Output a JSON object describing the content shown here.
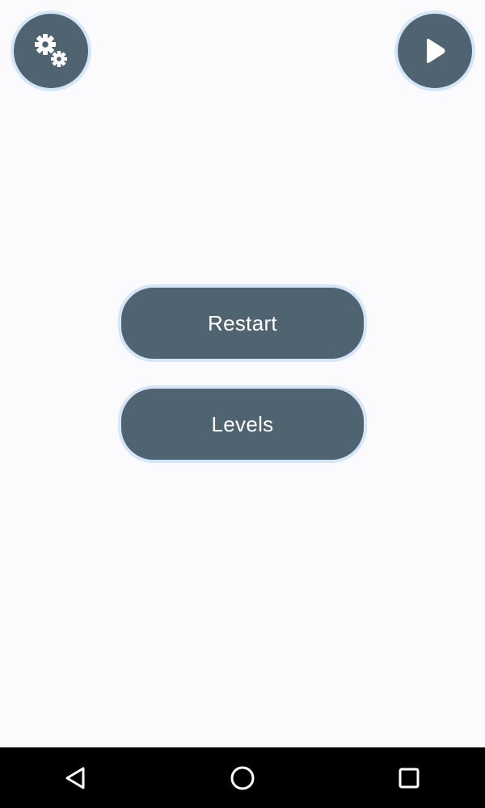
{
  "top_bar": {
    "settings_icon": "gears-icon",
    "play_icon": "play-icon"
  },
  "menu": {
    "restart_label": "Restart",
    "levels_label": "Levels"
  },
  "system_nav": {
    "back_icon": "triangle-back-icon",
    "home_icon": "circle-home-icon",
    "recents_icon": "square-recents-icon"
  },
  "colors": {
    "background": "#fbfbfe",
    "button_fill": "#506370",
    "button_ring": "#d4e6f7",
    "label_text": "#ffffff",
    "navbar": "#000000"
  }
}
